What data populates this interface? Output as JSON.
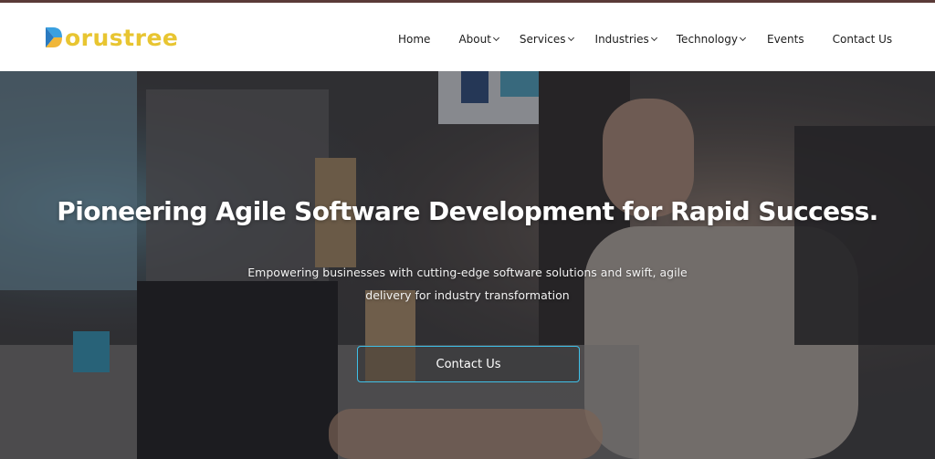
{
  "brand": {
    "name": "orustree",
    "logo_mark": "D-shaped logo mark",
    "colors": {
      "logo_text": "#e8c531",
      "logo_mark_top": "#3aa0e0",
      "logo_mark_bottom": "#f0b73a"
    }
  },
  "nav": {
    "items": [
      {
        "label": "Home",
        "has_dropdown": false
      },
      {
        "label": "About",
        "has_dropdown": true
      },
      {
        "label": "Services",
        "has_dropdown": true
      },
      {
        "label": "Industries",
        "has_dropdown": true
      },
      {
        "label": "Technology",
        "has_dropdown": true
      },
      {
        "label": "Events",
        "has_dropdown": false
      },
      {
        "label": "Contact Us",
        "has_dropdown": false
      }
    ]
  },
  "hero": {
    "title": "Pioneering Agile Software Development for Rapid Success.",
    "subtitle": "Empowering businesses with cutting-edge software solutions and swift, agile delivery for industry transformation",
    "cta_label": "Contact Us",
    "colors": {
      "cta_border": "#3fc0e8",
      "title": "#ffffff"
    }
  }
}
